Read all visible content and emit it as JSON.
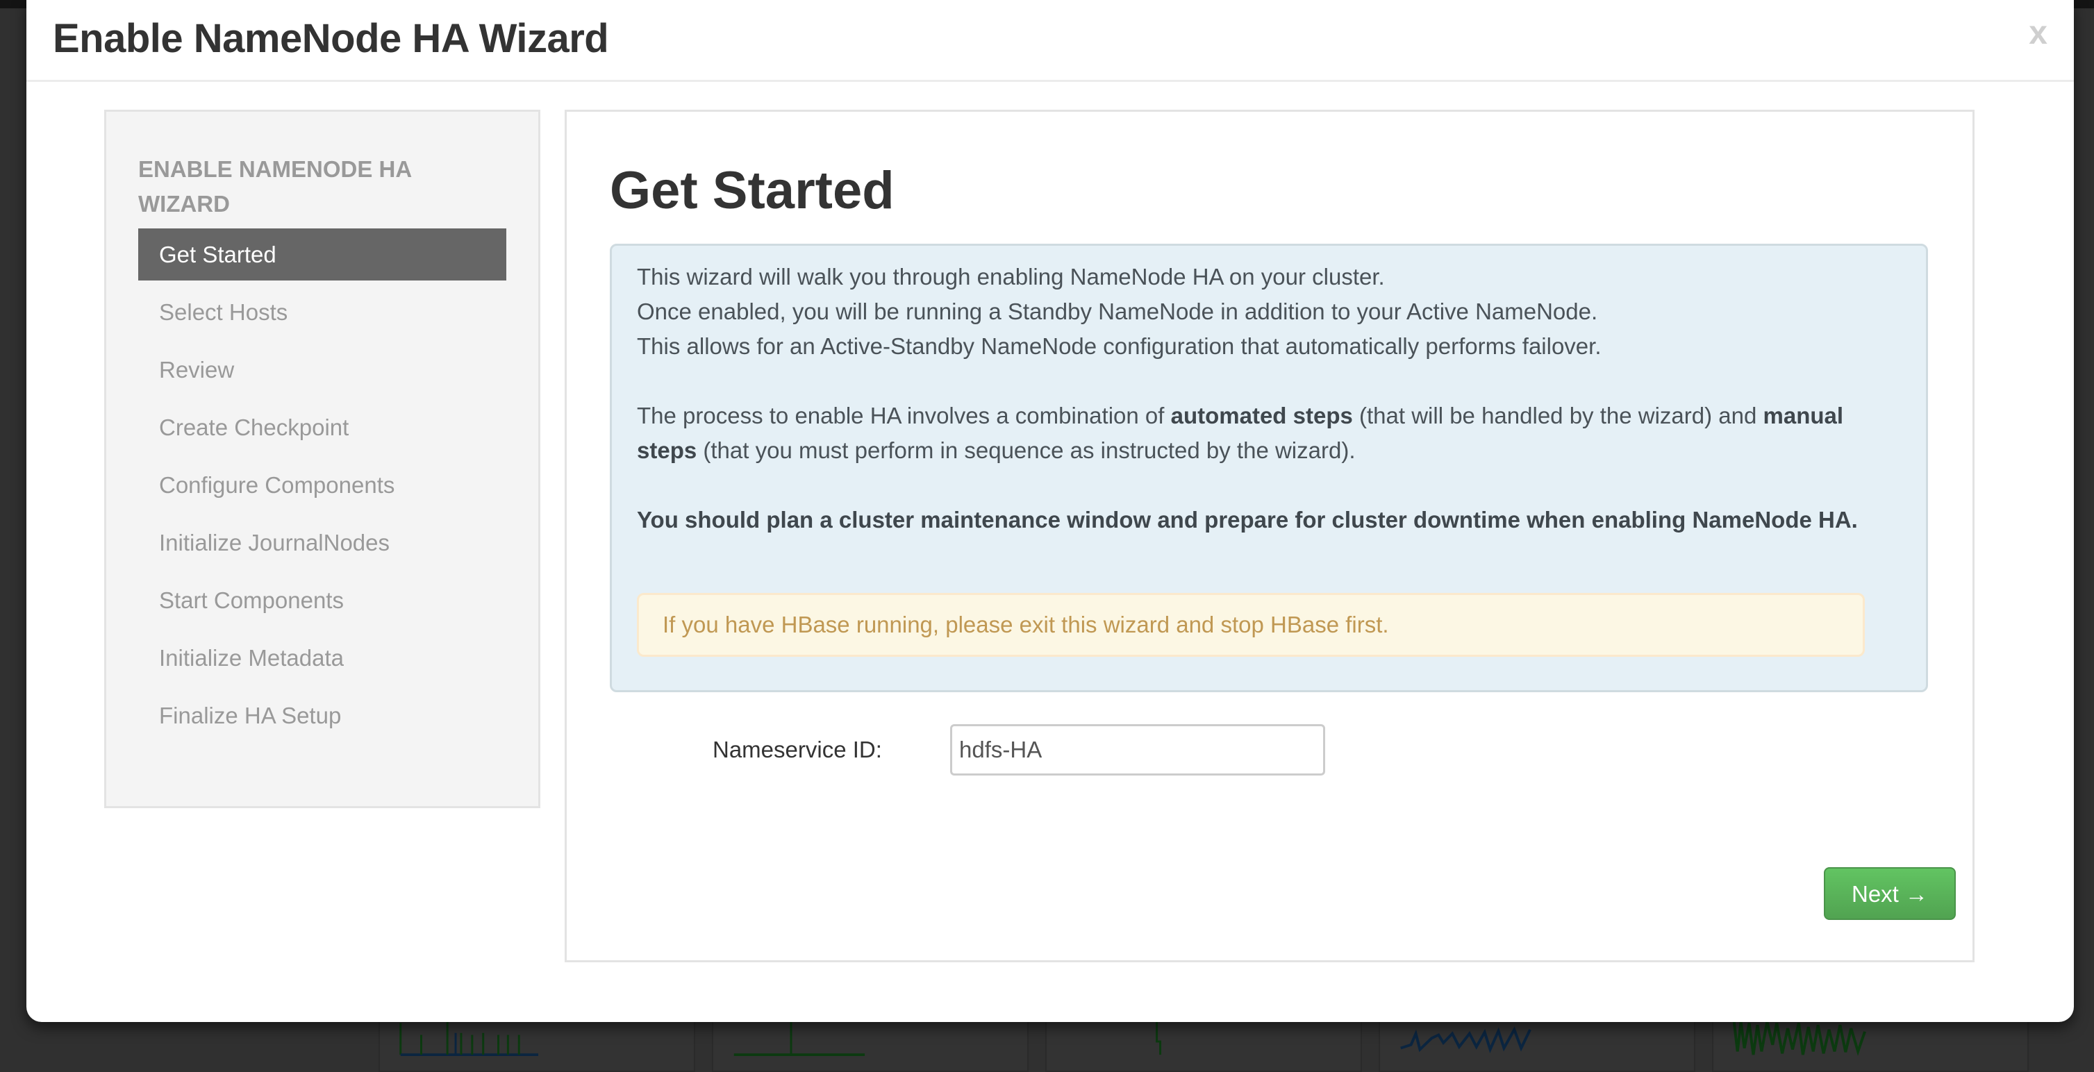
{
  "modal": {
    "title": "Enable NameNode HA Wizard",
    "close_label": "x"
  },
  "sidebar": {
    "heading": "ENABLE NAMENODE HA WIZARD",
    "active_index": 0,
    "steps": [
      {
        "label": "Get Started"
      },
      {
        "label": "Select Hosts"
      },
      {
        "label": "Review"
      },
      {
        "label": "Create Checkpoint"
      },
      {
        "label": "Configure Components"
      },
      {
        "label": "Initialize JournalNodes"
      },
      {
        "label": "Start Components"
      },
      {
        "label": "Initialize Metadata"
      },
      {
        "label": "Finalize HA Setup"
      }
    ]
  },
  "main": {
    "title": "Get Started",
    "info": {
      "line1": "This wizard will walk you through enabling NameNode HA on your cluster.",
      "line2": "Once enabled, you will be running a Standby NameNode in addition to your Active NameNode.",
      "line3": "This allows for an Active-Standby NameNode configuration that automatically performs failover.",
      "process_prefix": "The process to enable HA involves a combination of ",
      "process_bold1": "automated steps",
      "process_mid": " (that will be handled by the wizard) and ",
      "process_bold2": "manual steps",
      "process_suffix": " (that you must perform in sequence as instructed by the wizard).",
      "maintenance_warning": "You should plan a cluster maintenance window and prepare for cluster downtime when enabling NameNode HA."
    },
    "hbase_warning": "If you have HBase running, please exit this wizard and stop HBase first.",
    "nameservice": {
      "label": "Nameservice ID:",
      "value": "hdfs-HA"
    },
    "next_label": "Next →"
  },
  "colors": {
    "active_step_bg": "#666666",
    "info_bg": "#e5f0f6",
    "warning_bg": "#fcf7e4",
    "warning_text": "#c09853",
    "next_button": "#5bb75b"
  }
}
